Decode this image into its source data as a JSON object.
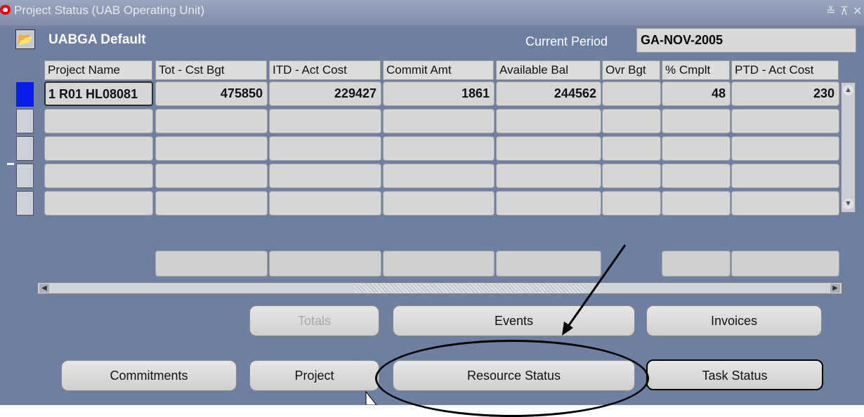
{
  "window": {
    "title": "Project Status (UAB Operating Unit)",
    "controls": [
      "≚",
      "⊼",
      "✕"
    ]
  },
  "header": {
    "folder_name": "UABGA Default",
    "period_label": "Current Period",
    "period_value": "GA-NOV-2005"
  },
  "table": {
    "columns": [
      "Project Name",
      "Tot - Cst Bgt",
      "ITD - Act Cost",
      "Commit Amt",
      "Available Bal",
      "Ovr Bgt",
      "% Cmplt",
      "PTD - Act Cost"
    ],
    "rows": [
      [
        "1 R01 HL08081",
        "475850",
        "229427",
        "1861",
        "244562",
        "",
        "48",
        "230"
      ],
      [
        "",
        "",
        "",
        "",
        "",
        "",
        "",
        ""
      ],
      [
        "",
        "",
        "",
        "",
        "",
        "",
        "",
        ""
      ],
      [
        "",
        "",
        "",
        "",
        "",
        "",
        "",
        ""
      ],
      [
        "",
        "",
        "",
        "",
        "",
        "",
        "",
        ""
      ]
    ]
  },
  "buttons": {
    "totals": "Totals",
    "events": "Events",
    "invoices": "Invoices",
    "commitments": "Commitments",
    "project": "Project",
    "resource_status": "Resource Status",
    "task_status": "Task Status"
  },
  "icons": {
    "app": "oracle-icon",
    "folder": "folder-open-icon"
  },
  "colors": {
    "window_bg": "#6e7fa1",
    "current_record": "#0b1de8"
  }
}
